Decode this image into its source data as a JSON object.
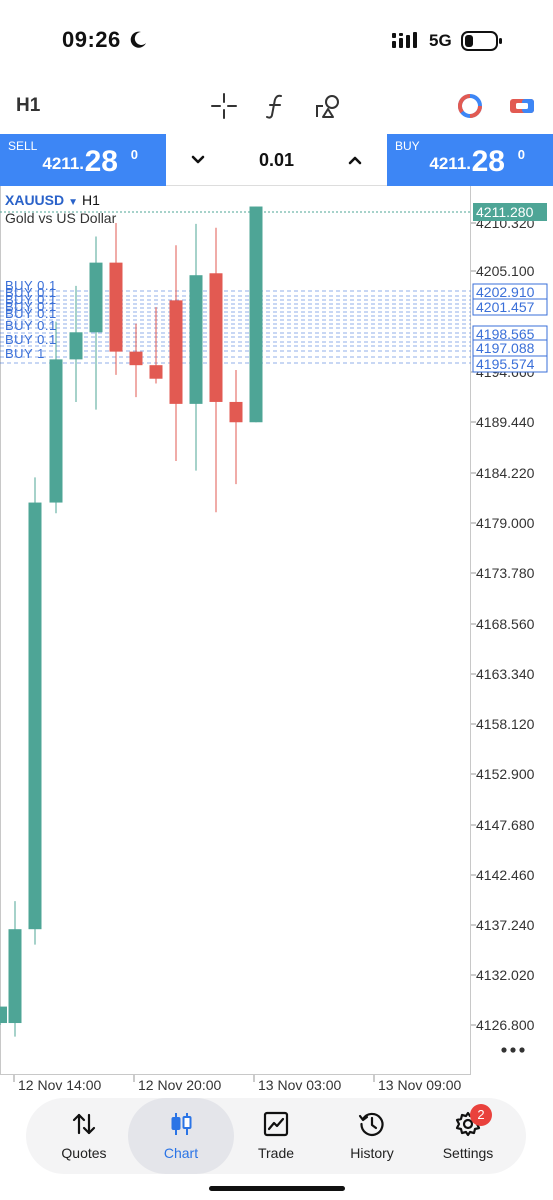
{
  "status_bar": {
    "time": "09:26",
    "network": "5G",
    "icons": [
      "moon-icon",
      "signal-icon",
      "battery-icon"
    ]
  },
  "toolbar": {
    "timeframe": "H1",
    "icons": [
      "crosshair-icon",
      "indicator-icon",
      "objects-icon",
      "trade-mode-icon",
      "one-click-icon"
    ]
  },
  "trade_bar": {
    "sell_label": "SELL",
    "sell_price_main": "4211.",
    "sell_price_big": "28",
    "sell_price_sup": "0",
    "buy_label": "BUY",
    "buy_price_main": "4211.",
    "buy_price_big": "28",
    "buy_price_sup": "0",
    "volume": "0.01",
    "colors": {
      "panel": "#3d86f5"
    }
  },
  "chart": {
    "symbol": "XAUUSD",
    "timeframe": "H1",
    "description": "Gold vs US Dollar",
    "colors": {
      "bull": "#4ea596",
      "bear": "#e25a52",
      "order_line": "#3a6fd8"
    }
  },
  "chart_data": {
    "type": "candlestick",
    "price_axis": [
      "4210.320",
      "4205.100",
      "4194.660",
      "4189.440",
      "4184.220",
      "4179.000",
      "4173.780",
      "4168.560",
      "4163.340",
      "4158.120",
      "4152.900",
      "4147.680",
      "4142.460",
      "4137.240",
      "4132.020",
      "4126.800"
    ],
    "time_axis": [
      "12 Nov 14:00",
      "12 Nov 20:00",
      "13 Nov 03:00",
      "13 Nov 09:00"
    ],
    "current_price": "4211.280",
    "order_price_labels": [
      "4202.910",
      "4201.457",
      "4198.565",
      "4197.088",
      "4195.574"
    ],
    "order_labels": [
      "BUY 0.1",
      "BUY 1"
    ],
    "candles": [
      {
        "open": 4126.9,
        "high": 4128.6,
        "low": 4126.7,
        "close": 4128.6
      },
      {
        "open": 4126.9,
        "high": 4139.5,
        "low": 4125.5,
        "close": 4136.6
      },
      {
        "open": 4136.6,
        "high": 4183.3,
        "low": 4135.0,
        "close": 4180.7
      },
      {
        "open": 4180.7,
        "high": 4199.4,
        "low": 4179.6,
        "close": 4195.5
      },
      {
        "open": 4195.5,
        "high": 4203.1,
        "low": 4191.1,
        "close": 4198.3
      },
      {
        "open": 4198.3,
        "high": 4208.2,
        "low": 4190.3,
        "close": 4205.5
      },
      {
        "open": 4205.5,
        "high": 4209.6,
        "low": 4193.9,
        "close": 4196.3
      },
      {
        "open": 4196.3,
        "high": 4199.2,
        "low": 4191.6,
        "close": 4194.9
      },
      {
        "open": 4194.9,
        "high": 4200.9,
        "low": 4193.0,
        "close": 4193.5
      },
      {
        "open": 4201.6,
        "high": 4207.3,
        "low": 4185.0,
        "close": 4190.9
      },
      {
        "open": 4190.9,
        "high": 4209.5,
        "low": 4184.0,
        "close": 4204.2
      },
      {
        "open": 4204.4,
        "high": 4209.1,
        "low": 4179.7,
        "close": 4191.1
      },
      {
        "open": 4191.1,
        "high": 4194.4,
        "low": 4182.6,
        "close": 4189.0
      },
      {
        "open": 4189.0,
        "high": 4211.3,
        "low": 4189.0,
        "close": 4211.3
      }
    ]
  },
  "bottom_nav": {
    "items": [
      {
        "label": "Quotes",
        "icon": "quotes-icon"
      },
      {
        "label": "Chart",
        "icon": "chart-icon"
      },
      {
        "label": "Trade",
        "icon": "trade-icon"
      },
      {
        "label": "History",
        "icon": "history-icon"
      },
      {
        "label": "Settings",
        "icon": "settings-icon"
      }
    ],
    "active": "Chart",
    "settings_badge": "2",
    "colors": {
      "active": "#2a74e6",
      "badge": "#e9413c"
    }
  }
}
